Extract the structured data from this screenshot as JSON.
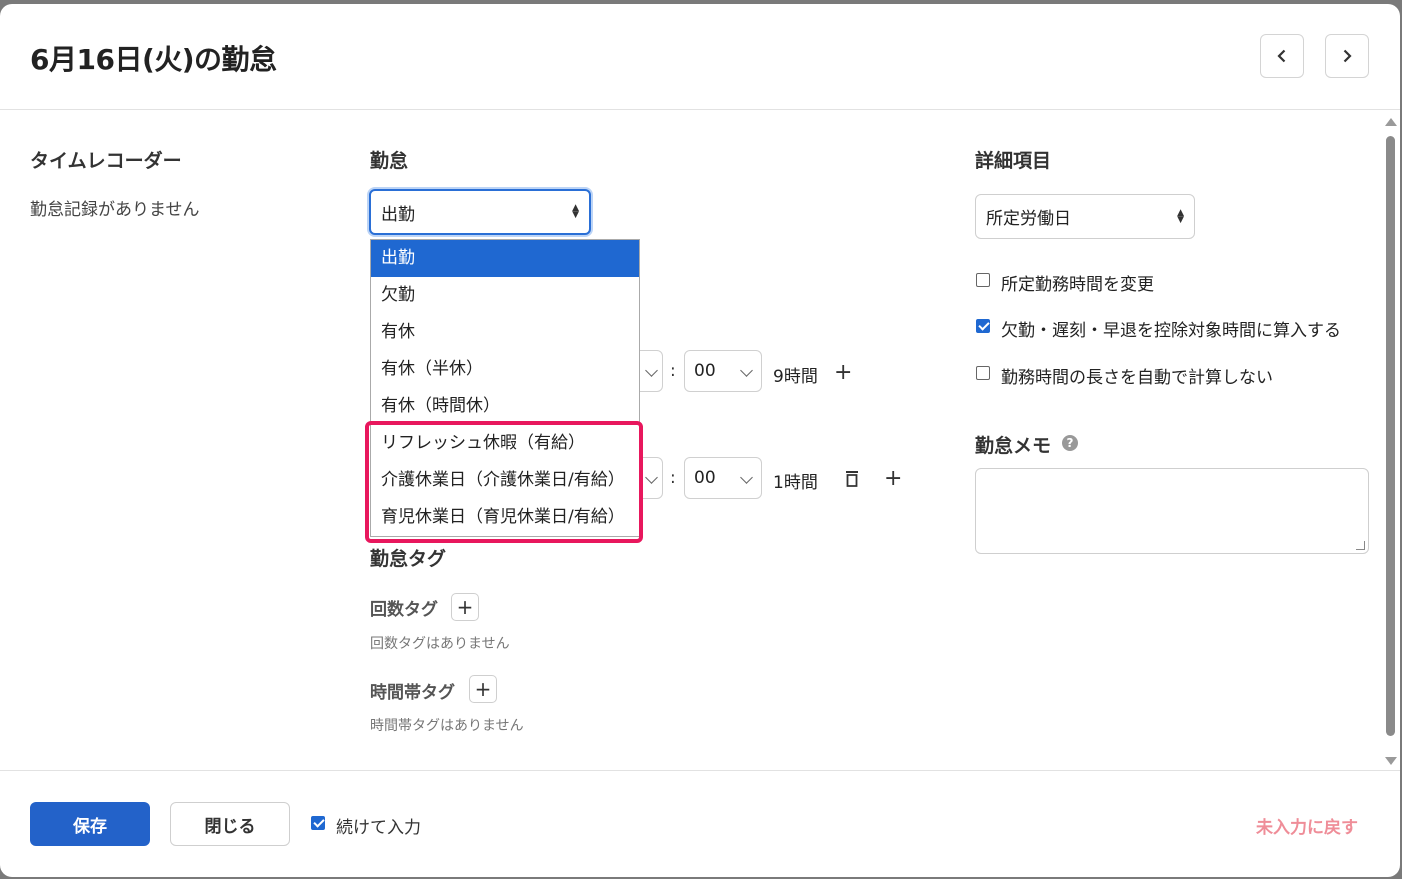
{
  "header": {
    "title": "6月16日(火)の勤怠"
  },
  "timerecorder": {
    "heading": "タイムレコーダー",
    "empty": "勤怠記録がありません"
  },
  "attendance": {
    "heading": "勤怠",
    "selected": "出勤",
    "options": [
      "出勤",
      "欠勤",
      "有休",
      "有休（半休）",
      "有休（時間休）",
      "リフレッシュ休暇（有給）",
      "介護休業日（介護休業日/有給）",
      "育児休業日（育児休業日/有給）"
    ],
    "row1": {
      "minutes": "00",
      "duration": "9時間"
    },
    "row2": {
      "minutes": "00",
      "duration": "1時間"
    },
    "colon": ":"
  },
  "tags": {
    "heading": "勤怠タグ",
    "count_heading": "回数タグ",
    "count_empty": "回数タグはありません",
    "time_heading": "時間帯タグ",
    "time_empty": "時間帯タグはありません"
  },
  "details": {
    "heading": "詳細項目",
    "day_type": "所定労働日",
    "checks": [
      {
        "label": "所定勤務時間を変更",
        "checked": false
      },
      {
        "label": "欠勤・遅刻・早退を控除対象時間に算入する",
        "checked": true
      },
      {
        "label": "勤務時間の長さを自動で計算しない",
        "checked": false
      }
    ],
    "memo_heading": "勤怠メモ",
    "help_glyph": "?"
  },
  "footer": {
    "save": "保存",
    "close": "閉じる",
    "continue_label": "続けて入力",
    "continue_checked": true,
    "reset": "未入力に戻す"
  },
  "colors": {
    "primary": "#2362c9",
    "highlight": "#e8175d",
    "reset": "#ef8d98"
  }
}
